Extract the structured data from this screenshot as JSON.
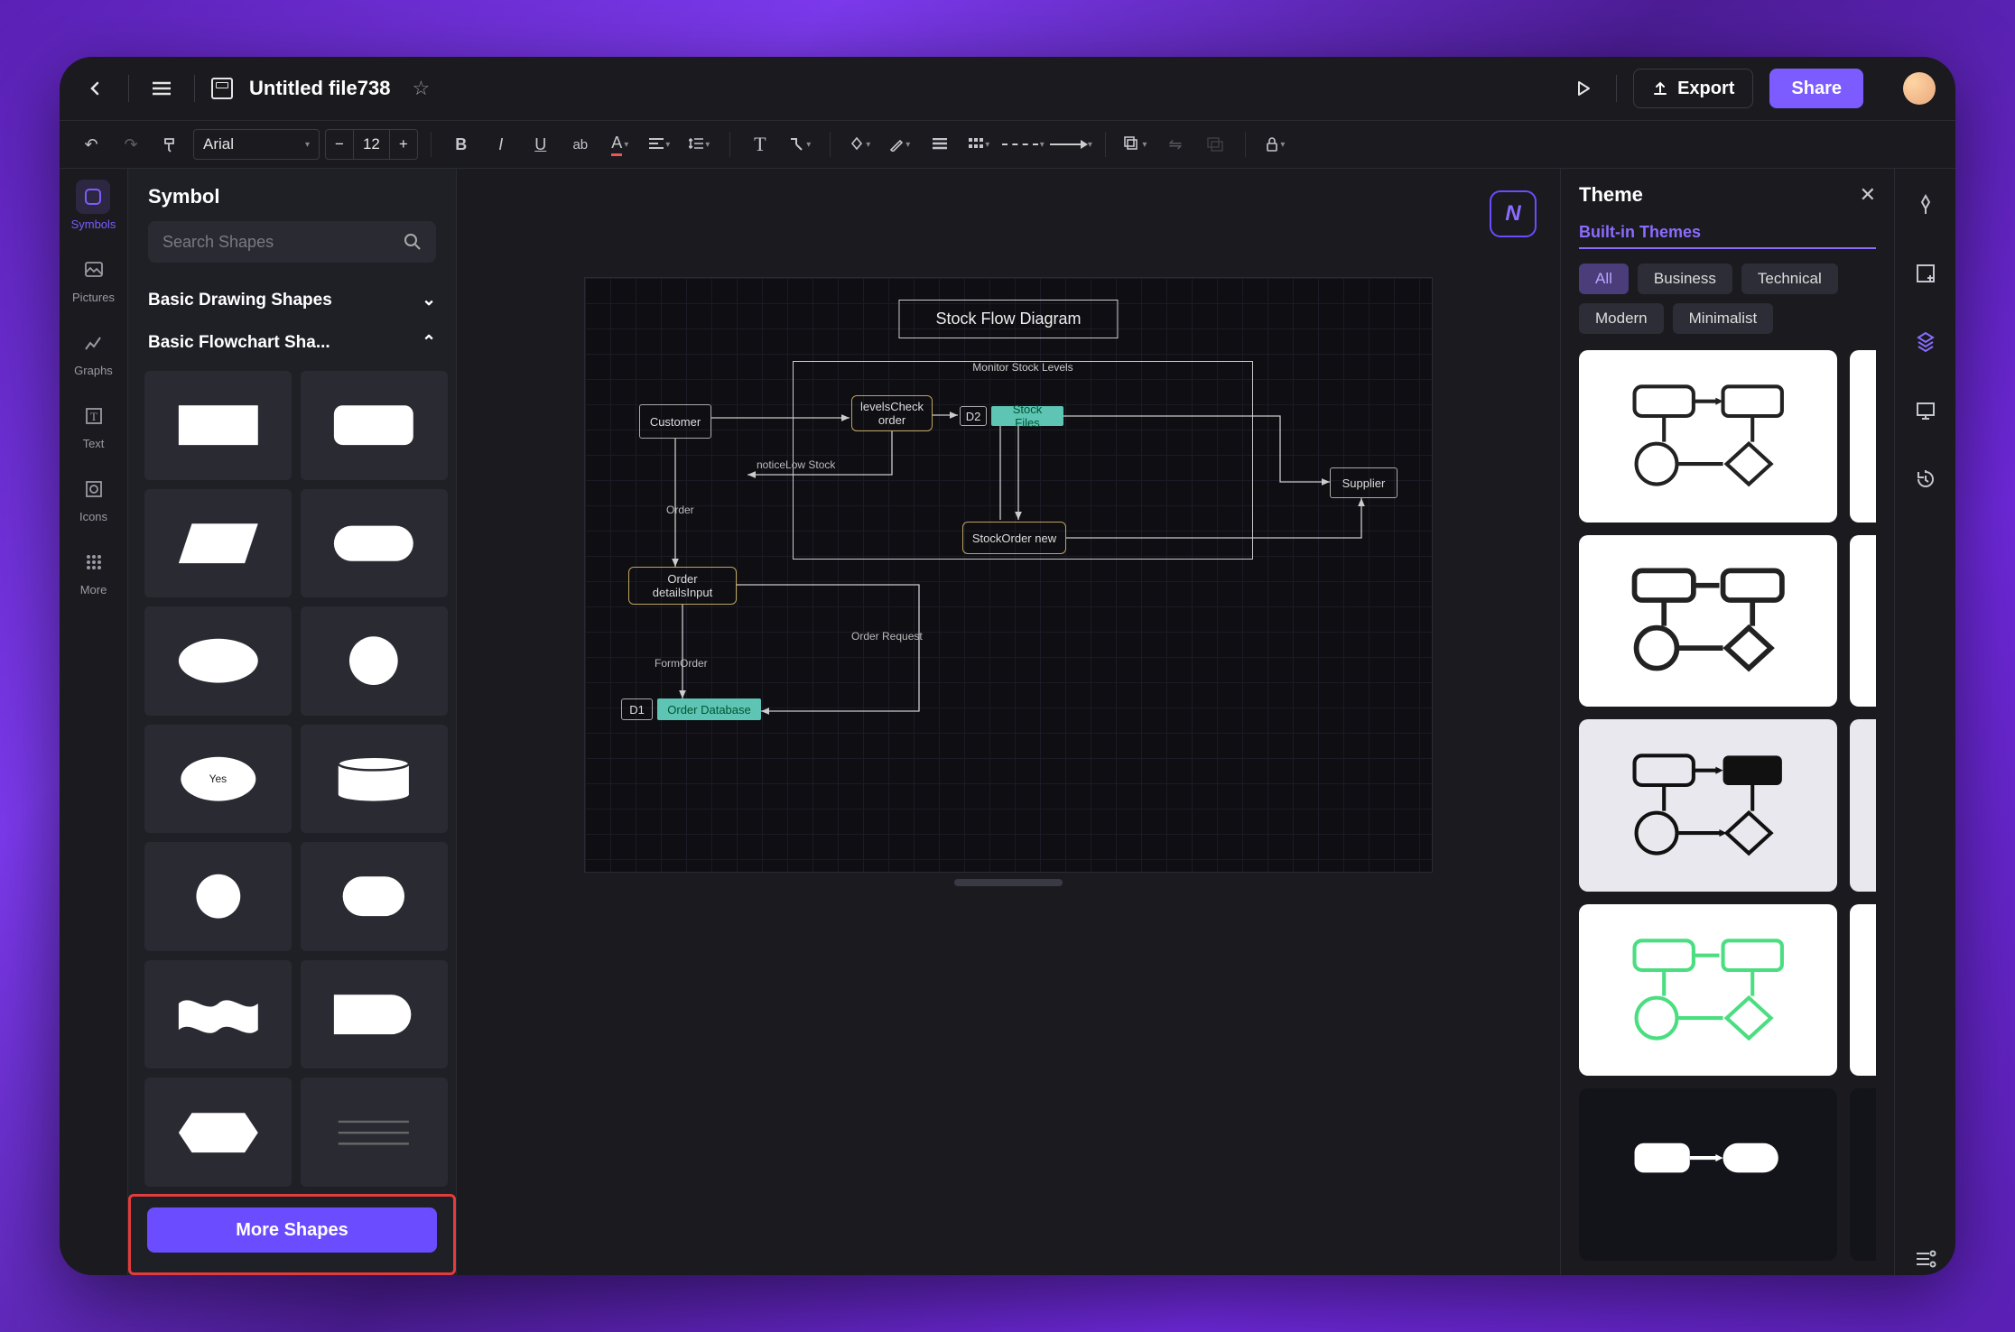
{
  "header": {
    "title": "Untitled file738",
    "export_label": "Export",
    "share_label": "Share"
  },
  "toolbar": {
    "font_name": "Arial",
    "font_size": "12"
  },
  "left_rail": {
    "items": [
      {
        "label": "Symbols"
      },
      {
        "label": "Pictures"
      },
      {
        "label": "Graphs"
      },
      {
        "label": "Text"
      },
      {
        "label": "Icons"
      },
      {
        "label": "More"
      }
    ]
  },
  "shape_panel": {
    "title": "Symbol",
    "search_placeholder": "Search Shapes",
    "sections": [
      {
        "title": "Basic Drawing Shapes"
      },
      {
        "title": "Basic Flowchart Sha..."
      }
    ],
    "more_button": "More Shapes",
    "yes_label": "Yes"
  },
  "theme_panel": {
    "title": "Theme",
    "tab": "Built-in Themes",
    "filters": [
      {
        "label": "All",
        "active": true
      },
      {
        "label": "Business"
      },
      {
        "label": "Technical"
      },
      {
        "label": "Modern"
      },
      {
        "label": "Minimalist"
      }
    ]
  },
  "diagram": {
    "title": "Stock Flow Diagram",
    "nodes": {
      "customer": "Customer",
      "check": "levelsCheck order",
      "d2": "D2",
      "stockfiles": "Stock Files",
      "supplier": "Supplier",
      "orderdetails": "Order detailsInput",
      "stockorder": "StockOrder new",
      "d1": "D1",
      "orderdb": "Order Database",
      "monitor": "Monitor Stock Levels"
    },
    "labels": {
      "order": "Order",
      "lowstock": "noticeLow Stock",
      "formorder": "FormOrder",
      "orderreq": "Order Request"
    }
  }
}
